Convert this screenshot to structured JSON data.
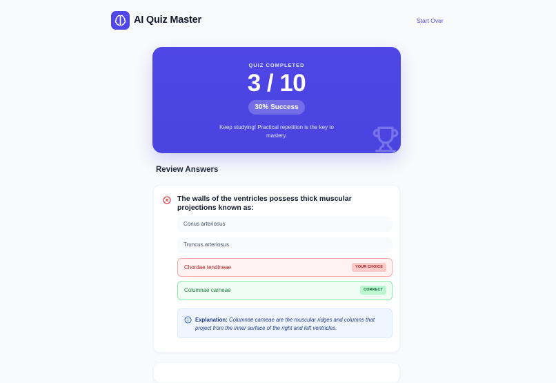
{
  "header": {
    "app_title": "AI Quiz Master",
    "start_over_label": "Start Over",
    "logo_icon": "brain-icon",
    "accent_color": "#4f46e5"
  },
  "result": {
    "label": "QUIZ COMPLETED",
    "score_text": "3 / 10",
    "success_text": "30% Success",
    "message": "Keep studying! Practical repetition is the key to mastery."
  },
  "review": {
    "heading": "Review Answers",
    "questions": [
      {
        "status": "incorrect",
        "status_icon": "x-circle-icon",
        "text": "The walls of the ventricles possess thick muscular projections known as:",
        "options": [
          {
            "label": "Conus arteriosus",
            "state": "neutral"
          },
          {
            "label": "Truncus arteriosus",
            "state": "neutral"
          },
          {
            "label": "Chordae tendineae",
            "state": "selected-wrong",
            "tag": "YOUR CHOICE"
          },
          {
            "label": "Columnae carneae",
            "state": "correct",
            "tag": "CORRECT"
          }
        ],
        "explanation_label": "Explanation:",
        "explanation_text": "Columnae carneae are the muscular ridges and columns that project from the inner surface of the right and left ventricles."
      }
    ]
  }
}
